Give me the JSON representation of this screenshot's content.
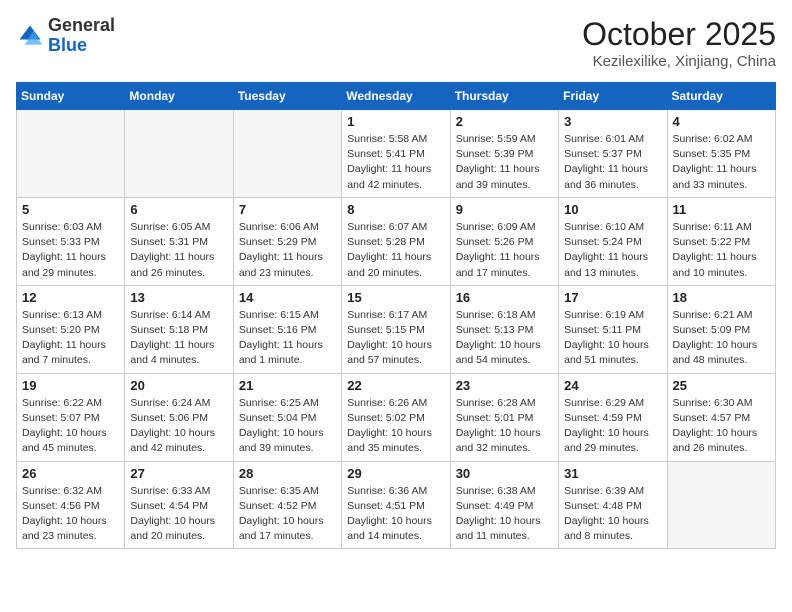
{
  "header": {
    "logo_line1": "General",
    "logo_line2": "Blue",
    "month": "October 2025",
    "location": "Kezilexilike, Xinjiang, China"
  },
  "days_of_week": [
    "Sunday",
    "Monday",
    "Tuesday",
    "Wednesday",
    "Thursday",
    "Friday",
    "Saturday"
  ],
  "weeks": [
    [
      {
        "day": "",
        "info": ""
      },
      {
        "day": "",
        "info": ""
      },
      {
        "day": "",
        "info": ""
      },
      {
        "day": "1",
        "info": "Sunrise: 5:58 AM\nSunset: 5:41 PM\nDaylight: 11 hours\nand 42 minutes."
      },
      {
        "day": "2",
        "info": "Sunrise: 5:59 AM\nSunset: 5:39 PM\nDaylight: 11 hours\nand 39 minutes."
      },
      {
        "day": "3",
        "info": "Sunrise: 6:01 AM\nSunset: 5:37 PM\nDaylight: 11 hours\nand 36 minutes."
      },
      {
        "day": "4",
        "info": "Sunrise: 6:02 AM\nSunset: 5:35 PM\nDaylight: 11 hours\nand 33 minutes."
      }
    ],
    [
      {
        "day": "5",
        "info": "Sunrise: 6:03 AM\nSunset: 5:33 PM\nDaylight: 11 hours\nand 29 minutes."
      },
      {
        "day": "6",
        "info": "Sunrise: 6:05 AM\nSunset: 5:31 PM\nDaylight: 11 hours\nand 26 minutes."
      },
      {
        "day": "7",
        "info": "Sunrise: 6:06 AM\nSunset: 5:29 PM\nDaylight: 11 hours\nand 23 minutes."
      },
      {
        "day": "8",
        "info": "Sunrise: 6:07 AM\nSunset: 5:28 PM\nDaylight: 11 hours\nand 20 minutes."
      },
      {
        "day": "9",
        "info": "Sunrise: 6:09 AM\nSunset: 5:26 PM\nDaylight: 11 hours\nand 17 minutes."
      },
      {
        "day": "10",
        "info": "Sunrise: 6:10 AM\nSunset: 5:24 PM\nDaylight: 11 hours\nand 13 minutes."
      },
      {
        "day": "11",
        "info": "Sunrise: 6:11 AM\nSunset: 5:22 PM\nDaylight: 11 hours\nand 10 minutes."
      }
    ],
    [
      {
        "day": "12",
        "info": "Sunrise: 6:13 AM\nSunset: 5:20 PM\nDaylight: 11 hours\nand 7 minutes."
      },
      {
        "day": "13",
        "info": "Sunrise: 6:14 AM\nSunset: 5:18 PM\nDaylight: 11 hours\nand 4 minutes."
      },
      {
        "day": "14",
        "info": "Sunrise: 6:15 AM\nSunset: 5:16 PM\nDaylight: 11 hours\nand 1 minute."
      },
      {
        "day": "15",
        "info": "Sunrise: 6:17 AM\nSunset: 5:15 PM\nDaylight: 10 hours\nand 57 minutes."
      },
      {
        "day": "16",
        "info": "Sunrise: 6:18 AM\nSunset: 5:13 PM\nDaylight: 10 hours\nand 54 minutes."
      },
      {
        "day": "17",
        "info": "Sunrise: 6:19 AM\nSunset: 5:11 PM\nDaylight: 10 hours\nand 51 minutes."
      },
      {
        "day": "18",
        "info": "Sunrise: 6:21 AM\nSunset: 5:09 PM\nDaylight: 10 hours\nand 48 minutes."
      }
    ],
    [
      {
        "day": "19",
        "info": "Sunrise: 6:22 AM\nSunset: 5:07 PM\nDaylight: 10 hours\nand 45 minutes."
      },
      {
        "day": "20",
        "info": "Sunrise: 6:24 AM\nSunset: 5:06 PM\nDaylight: 10 hours\nand 42 minutes."
      },
      {
        "day": "21",
        "info": "Sunrise: 6:25 AM\nSunset: 5:04 PM\nDaylight: 10 hours\nand 39 minutes."
      },
      {
        "day": "22",
        "info": "Sunrise: 6:26 AM\nSunset: 5:02 PM\nDaylight: 10 hours\nand 35 minutes."
      },
      {
        "day": "23",
        "info": "Sunrise: 6:28 AM\nSunset: 5:01 PM\nDaylight: 10 hours\nand 32 minutes."
      },
      {
        "day": "24",
        "info": "Sunrise: 6:29 AM\nSunset: 4:59 PM\nDaylight: 10 hours\nand 29 minutes."
      },
      {
        "day": "25",
        "info": "Sunrise: 6:30 AM\nSunset: 4:57 PM\nDaylight: 10 hours\nand 26 minutes."
      }
    ],
    [
      {
        "day": "26",
        "info": "Sunrise: 6:32 AM\nSunset: 4:56 PM\nDaylight: 10 hours\nand 23 minutes."
      },
      {
        "day": "27",
        "info": "Sunrise: 6:33 AM\nSunset: 4:54 PM\nDaylight: 10 hours\nand 20 minutes."
      },
      {
        "day": "28",
        "info": "Sunrise: 6:35 AM\nSunset: 4:52 PM\nDaylight: 10 hours\nand 17 minutes."
      },
      {
        "day": "29",
        "info": "Sunrise: 6:36 AM\nSunset: 4:51 PM\nDaylight: 10 hours\nand 14 minutes."
      },
      {
        "day": "30",
        "info": "Sunrise: 6:38 AM\nSunset: 4:49 PM\nDaylight: 10 hours\nand 11 minutes."
      },
      {
        "day": "31",
        "info": "Sunrise: 6:39 AM\nSunset: 4:48 PM\nDaylight: 10 hours\nand 8 minutes."
      },
      {
        "day": "",
        "info": ""
      }
    ]
  ]
}
